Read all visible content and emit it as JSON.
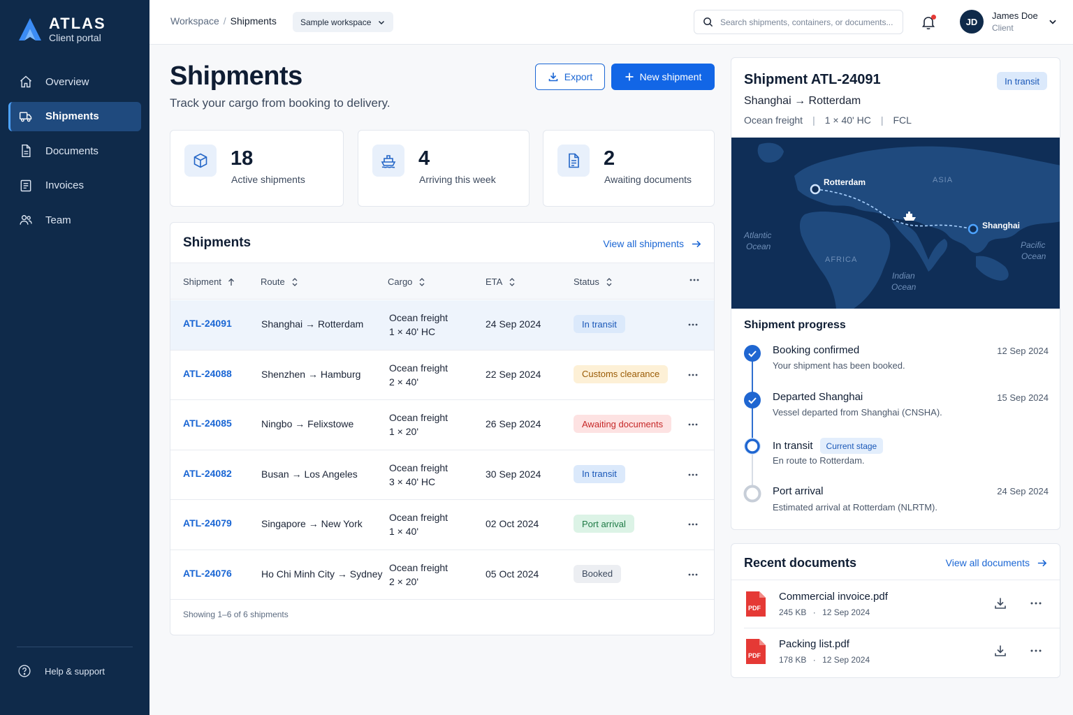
{
  "brand": {
    "name": "ATLAS",
    "subtitle": "Client portal"
  },
  "sidebar": {
    "items": [
      {
        "label": "Overview",
        "icon": "home-icon",
        "active": false
      },
      {
        "label": "Shipments",
        "icon": "truck-icon",
        "active": true
      },
      {
        "label": "Documents",
        "icon": "document-icon",
        "active": false
      },
      {
        "label": "Invoices",
        "icon": "invoice-icon",
        "active": false
      },
      {
        "label": "Team",
        "icon": "team-icon",
        "active": false
      }
    ],
    "help_label": "Help & support"
  },
  "topbar": {
    "breadcrumb_root": "Workspace",
    "breadcrumb_sep": "/",
    "breadcrumb_current": "Shipments",
    "workspace_select": "Sample workspace",
    "search_placeholder": "Search shipments, containers, or documents...",
    "user": {
      "initials": "JD",
      "name": "James Doe",
      "role": "Client"
    }
  },
  "page": {
    "title": "Shipments",
    "subtitle": "Track your cargo from booking to delivery.",
    "export_label": "Export",
    "new_label": "New shipment"
  },
  "stats": [
    {
      "value": "18",
      "label": "Active shipments",
      "icon": "box-icon"
    },
    {
      "value": "4",
      "label": "Arriving this week",
      "icon": "ship-icon"
    },
    {
      "value": "2",
      "label": "Awaiting documents",
      "icon": "document-icon"
    }
  ],
  "table": {
    "title": "Shipments",
    "view_all": "View all shipments",
    "columns": [
      "Shipment",
      "Route",
      "Cargo",
      "ETA",
      "Status"
    ],
    "rows": [
      {
        "id": "ATL-24091",
        "route": "Shanghai → Rotterdam",
        "cargo1": "Ocean freight",
        "cargo2": "1 × 40' HC",
        "eta": "24 Sep 2024",
        "status": "In transit",
        "status_bg": "#dbe9fb",
        "status_fg": "#1a58b8",
        "selected": true
      },
      {
        "id": "ATL-24088",
        "route": "Shenzhen → Hamburg",
        "cargo1": "Ocean freight",
        "cargo2": "2 × 40'",
        "eta": "22 Sep 2024",
        "status": "Customs clearance",
        "status_bg": "#fdf0d6",
        "status_fg": "#9a5b05",
        "selected": false
      },
      {
        "id": "ATL-24085",
        "route": "Ningbo → Felixstowe",
        "cargo1": "Ocean freight",
        "cargo2": "1 × 20'",
        "eta": "26 Sep 2024",
        "status": "Awaiting documents",
        "status_bg": "#fde2e2",
        "status_fg": "#c62828",
        "selected": false
      },
      {
        "id": "ATL-24082",
        "route": "Busan → Los Angeles",
        "cargo1": "Ocean freight",
        "cargo2": "3 × 40' HC",
        "eta": "30 Sep 2024",
        "status": "In transit",
        "status_bg": "#dbe9fb",
        "status_fg": "#1a58b8",
        "selected": false
      },
      {
        "id": "ATL-24079",
        "route": "Singapore → New York",
        "cargo1": "Ocean freight",
        "cargo2": "1 × 40'",
        "eta": "02 Oct 2024",
        "status": "Port arrival",
        "status_bg": "#dcf3e6",
        "status_fg": "#1e7a45",
        "selected": false
      },
      {
        "id": "ATL-24076",
        "route": "Ho Chi Minh City → Sydney",
        "cargo1": "Ocean freight",
        "cargo2": "2 × 20'",
        "eta": "05 Oct 2024",
        "status": "Booked",
        "status_bg": "#eceef2",
        "status_fg": "#3d4a5e",
        "selected": false
      }
    ],
    "footer": "Showing 1–6 of 6 shipments"
  },
  "detail": {
    "title": "Shipment ATL-24091",
    "status": "In transit",
    "route": "Shanghai → Rotterdam",
    "mode": "Ocean freight",
    "container": "1 × 40' HC",
    "load": "FCL",
    "map": {
      "origin": "Shanghai",
      "destination": "Rotterdam",
      "labels": [
        "ASIA",
        "AFRICA",
        "Atlantic",
        "Ocean",
        "Pacific",
        "Ocean",
        "Indian",
        "Ocean"
      ]
    },
    "progress_title": "Shipment progress",
    "steps": [
      {
        "title": "Booking confirmed",
        "desc": "Your shipment has been booked.",
        "date": "12 Sep 2024",
        "state": "done",
        "tag": ""
      },
      {
        "title": "Departed Shanghai",
        "desc": "Vessel departed from Shanghai (CNSHA).",
        "date": "15 Sep 2024",
        "state": "done",
        "tag": ""
      },
      {
        "title": "In transit",
        "desc": "En route to Rotterdam.",
        "date": "",
        "state": "current",
        "tag": "Current stage"
      },
      {
        "title": "Port arrival",
        "desc": "Estimated arrival at Rotterdam (NLRTM).",
        "date": "24 Sep 2024",
        "state": "pending",
        "tag": ""
      }
    ]
  },
  "documents": {
    "title": "Recent documents",
    "view_all": "View all documents",
    "items": [
      {
        "name": "Commercial invoice.pdf",
        "size": "245 KB",
        "date": "12 Sep 2024",
        "type": "PDF"
      },
      {
        "name": "Packing list.pdf",
        "size": "178 KB",
        "date": "12 Sep 2024",
        "type": "PDF"
      }
    ],
    "meta_sep": "·"
  },
  "colors": {
    "sidebar": "#0f2a4a",
    "primary": "#1266e6",
    "link": "#1a66d4"
  }
}
